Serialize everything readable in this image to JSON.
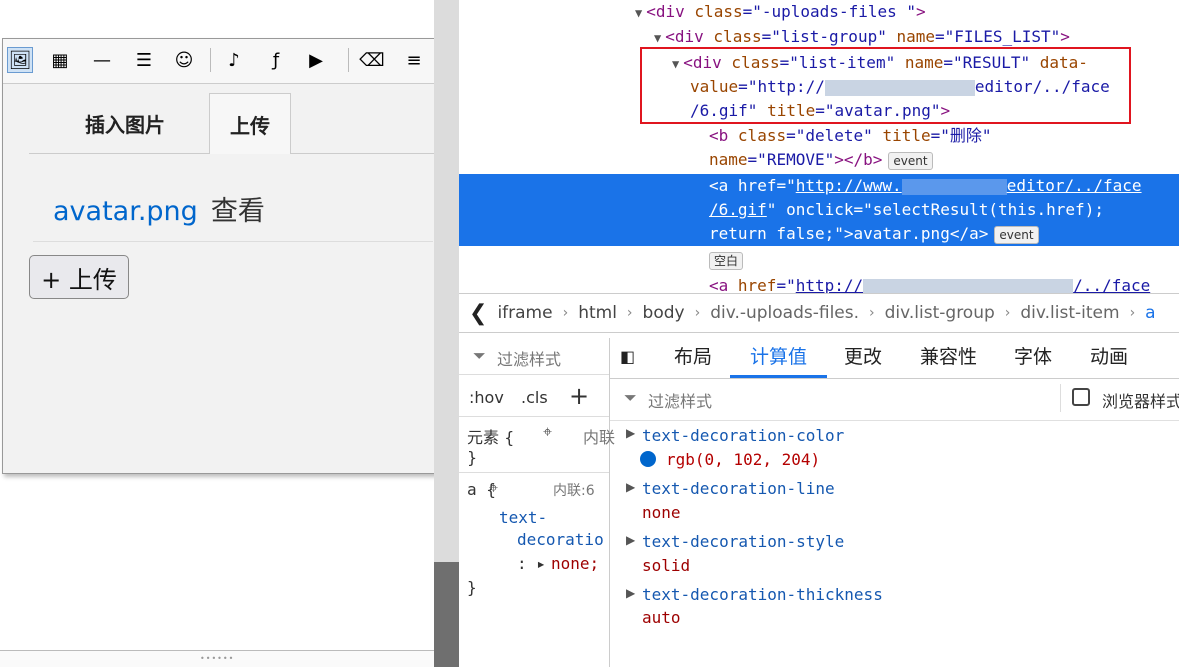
{
  "editor": {
    "toolbar_icons": [
      "image-icon",
      "table-icon",
      "horizontal-rule-icon",
      "indent-icon",
      "emoji-icon",
      "music-icon",
      "flash-icon",
      "video-icon",
      "clean-format-icon",
      "align-icon"
    ],
    "tabs": [
      {
        "label": "插入图片"
      },
      {
        "label": "上传"
      }
    ],
    "result": {
      "link": "avatar.png",
      "view": "查看"
    },
    "upload_button": "+ 上传"
  },
  "devtools": {
    "dom": {
      "l1_tag": "div",
      "l1_attr": "class",
      "l1_val": "-uploads-files ",
      "l2_tag": "div",
      "l2_attr1": "class",
      "l2_val1": "list-group",
      "l2_attr2": "name",
      "l2_val2": "FILES_LIST",
      "l3_tag": "div",
      "l3_attr1": "class",
      "l3_val1": "list-item",
      "l3_attr2": "name",
      "l3_val2": "RESULT",
      "l3_attr3": "data-",
      "l3b_attr": "value",
      "l3b_val_a": "http://",
      "l3b_val_b": "editor/../face",
      "l3c_val": "/6.gif",
      "l3c_attr": "title",
      "l3c_val2": "avatar.png",
      "b_tag": "b",
      "b_attr1": "class",
      "b_val1": "delete",
      "b_attr2": "title",
      "b_val2": "删除",
      "b2_attr": "name",
      "b2_val": "REMOVE",
      "event": "event",
      "a_tag": "a",
      "a_attr": "href",
      "a_val_a": "http://www.",
      "a_val_b": "editor/../face",
      "a2_val": "/6.gif",
      "a2_attr": "onclick",
      "a2_val2": "selectResult(this.href);",
      "a3_text": "return false;\">avatar.png</a>",
      "blank": "空白",
      "a4_val_a": "http://",
      "a4_val_b": "/../face"
    },
    "breadcrumb": [
      "iframe",
      "html",
      "body",
      "div.-uploads-files.",
      "div.list-group",
      "div.list-item",
      "a"
    ],
    "styles": {
      "filter": "过滤样式",
      "hov": ":hov",
      "cls": ".cls",
      "element_rule": "元素 {",
      "inline_hint": "内联",
      "close": "}",
      "a_rule": "a {",
      "a_inline": "内联:6",
      "prop1": "text-",
      "prop2": "decoratio",
      "prop_val": "none;"
    },
    "panel_tabs": [
      "布局",
      "计算值",
      "更改",
      "兼容性",
      "字体",
      "动画"
    ],
    "computed_filter": "过滤样式",
    "browser_styles": "浏览器样式",
    "computed": [
      {
        "name": "text-decoration-color",
        "value": "rgb(0, 102, 204)"
      },
      {
        "name": "text-decoration-line",
        "value": "none"
      },
      {
        "name": "text-decoration-style",
        "value": "solid"
      },
      {
        "name": "text-decoration-thickness",
        "value": "auto"
      }
    ],
    "colors": {
      "accent": "#1a73e8",
      "swatch": "#0066cc"
    }
  }
}
